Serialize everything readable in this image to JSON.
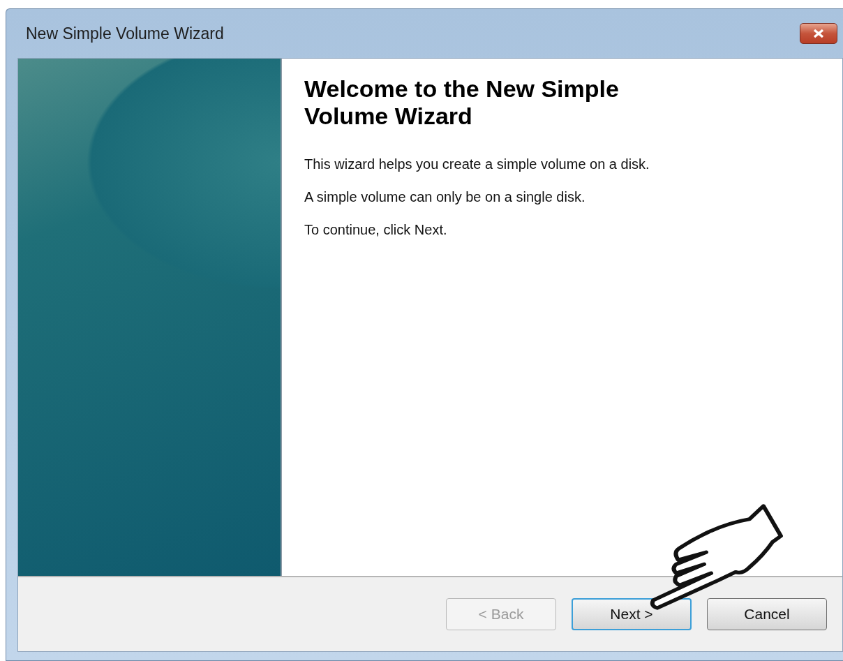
{
  "window": {
    "title": "New Simple Volume Wizard"
  },
  "heading": "Welcome to the New Simple Volume Wizard",
  "paragraphs": [
    "This wizard helps you create a simple volume on a disk.",
    "A simple volume can only be on a single disk.",
    "To continue, click Next."
  ],
  "buttons": [
    {
      "label": "< Back",
      "disabled": true,
      "default": false
    },
    {
      "label": "Next >",
      "disabled": false,
      "default": true
    },
    {
      "label": "Cancel",
      "disabled": false,
      "default": false
    }
  ]
}
